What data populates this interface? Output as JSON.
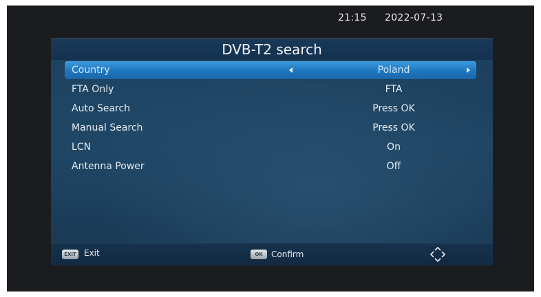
{
  "status": {
    "time": "21:15",
    "date": "2022-07-13"
  },
  "menu": {
    "title": "DVB-T2 search",
    "items": [
      {
        "label": "Country",
        "value": "Poland"
      },
      {
        "label": "FTA Only",
        "value": "FTA"
      },
      {
        "label": "Auto Search",
        "value": "Press OK"
      },
      {
        "label": "Manual Search",
        "value": "Press OK"
      },
      {
        "label": "LCN",
        "value": "On"
      },
      {
        "label": "Antenna Power",
        "value": "Off"
      }
    ]
  },
  "footer": {
    "exit_key": "EXIT",
    "exit_label": "Exit",
    "ok_key": "OK",
    "ok_label": "Confirm",
    "nav_icon": "navigation-arrows-icon"
  },
  "colors": {
    "highlight": "#2a85cc",
    "panel": "#1e4463",
    "text": "#e6ebef"
  }
}
